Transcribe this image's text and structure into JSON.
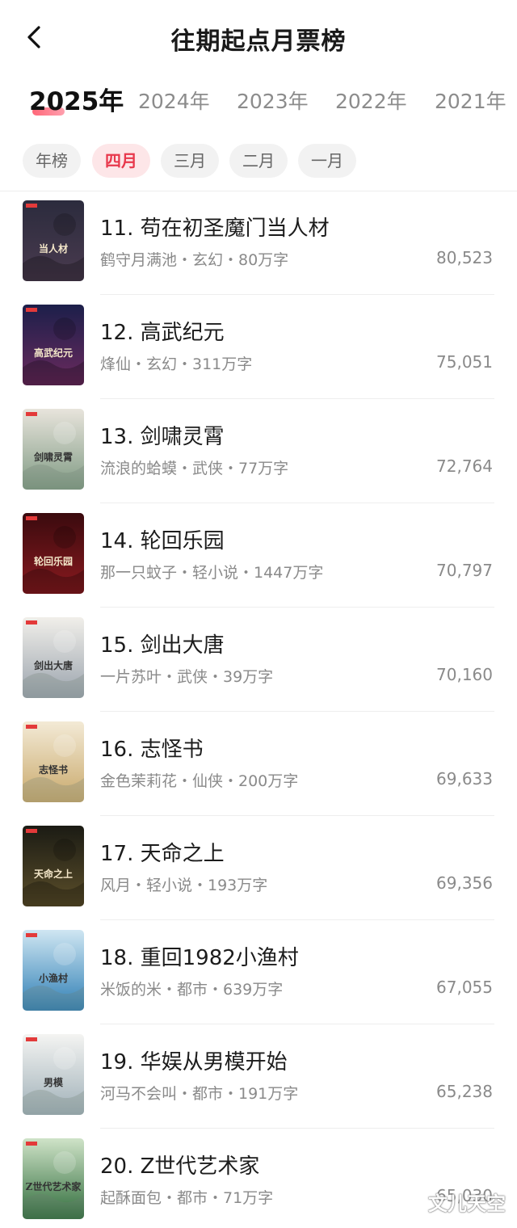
{
  "header": {
    "title": "往期起点月票榜"
  },
  "years": [
    {
      "label": "2025年",
      "active": true
    },
    {
      "label": "2024年",
      "active": false
    },
    {
      "label": "2023年",
      "active": false
    },
    {
      "label": "2022年",
      "active": false
    },
    {
      "label": "2021年",
      "active": false
    }
  ],
  "months": [
    {
      "label": "年榜",
      "active": false
    },
    {
      "label": "四月",
      "active": true
    },
    {
      "label": "三月",
      "active": false
    },
    {
      "label": "二月",
      "active": false
    },
    {
      "label": "一月",
      "active": false
    }
  ],
  "books": [
    {
      "title": "11. 苟在初圣魔门当人材",
      "meta": "鹤守月满池・玄幻・80万字",
      "votes": "80,523",
      "cover_colors": [
        "#2b2b3d",
        "#4a3b4f"
      ],
      "cover_text": "当人材"
    },
    {
      "title": "12. 高武纪元",
      "meta": "烽仙・玄幻・311万字",
      "votes": "75,051",
      "cover_colors": [
        "#1c1f4a",
        "#6b2a5e"
      ],
      "cover_text": "高武纪元"
    },
    {
      "title": "13. 剑啸灵霄",
      "meta": "流浪的蛤蟆・武侠・77万字",
      "votes": "72,764",
      "cover_colors": [
        "#e8e4dc",
        "#7f9a83"
      ],
      "cover_text": "剑啸灵霄"
    },
    {
      "title": "14. 轮回乐园",
      "meta": "那一只蚊子・轻小说・1447万字",
      "votes": "70,797",
      "cover_colors": [
        "#3a0a0e",
        "#8a1a1f"
      ],
      "cover_text": "轮回乐园"
    },
    {
      "title": "15. 剑出大唐",
      "meta": "一片苏叶・武侠・39万字",
      "votes": "70,160",
      "cover_colors": [
        "#f1efea",
        "#9aa3ad"
      ],
      "cover_text": "剑出大唐"
    },
    {
      "title": "16. 志怪书",
      "meta": "金色茉莉花・仙侠・200万字",
      "votes": "69,633",
      "cover_colors": [
        "#f3ead6",
        "#c9a96b"
      ],
      "cover_text": "志怪书"
    },
    {
      "title": "17. 天命之上",
      "meta": "风月・轻小说・193万字",
      "votes": "69,356",
      "cover_colors": [
        "#1b1b14",
        "#5c4f2a"
      ],
      "cover_text": "天命之上"
    },
    {
      "title": "18. 重回1982小渔村",
      "meta": "米饭的米・都市・639万字",
      "votes": "67,055",
      "cover_colors": [
        "#cfe6f2",
        "#2f7fb5"
      ],
      "cover_text": "小渔村"
    },
    {
      "title": "19. 华娱从男模开始",
      "meta": "河马不会叫・都市・191万字",
      "votes": "65,238",
      "cover_colors": [
        "#f4f4f2",
        "#9fb0b8"
      ],
      "cover_text": "男模"
    },
    {
      "title": "20. Z世代艺术家",
      "meta": "起酥面包・都市・71万字",
      "votes": "65,030",
      "cover_colors": [
        "#cfe3c8",
        "#2e6b3a"
      ],
      "cover_text": "Z世代艺术家"
    }
  ],
  "watermark": "文儿天空",
  "colors": {
    "accent": "#e8384c",
    "chip_bg": "#f2f2f2",
    "chip_active_bg": "#fde6e8",
    "muted_text": "#8a8a8a"
  },
  "icons": {
    "back": "chevron-left-icon"
  }
}
